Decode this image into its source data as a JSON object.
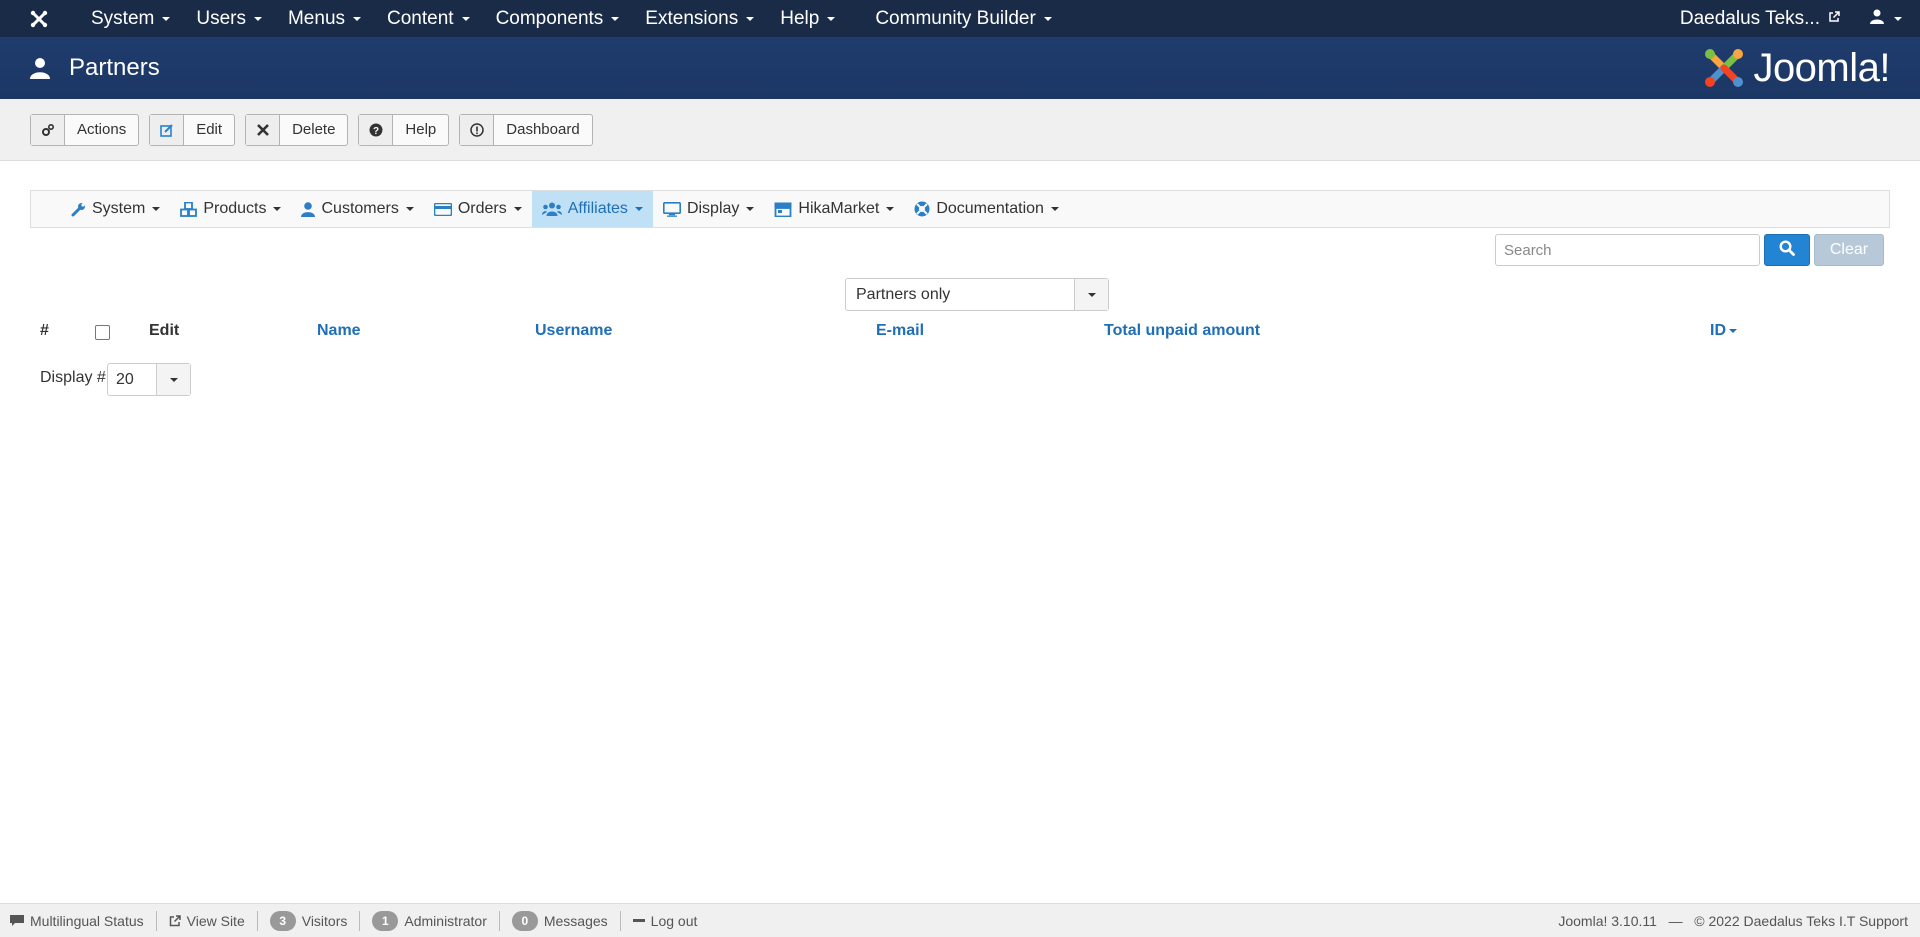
{
  "topnav": {
    "menus": [
      {
        "label": "System"
      },
      {
        "label": "Users"
      },
      {
        "label": "Menus"
      },
      {
        "label": "Content"
      },
      {
        "label": "Components"
      },
      {
        "label": "Extensions"
      },
      {
        "label": "Help"
      }
    ],
    "community_builder": "Community Builder",
    "site_name": "Daedalus Teks..."
  },
  "header": {
    "title": "Partners",
    "logo_text": "Joomla!"
  },
  "toolbar": {
    "actions": "Actions",
    "edit": "Edit",
    "delete": "Delete",
    "help": "Help",
    "dashboard": "Dashboard"
  },
  "submenu": {
    "items": [
      {
        "label": "System",
        "icon": "wrench-icon"
      },
      {
        "label": "Products",
        "icon": "cubes-icon"
      },
      {
        "label": "Customers",
        "icon": "user-icon"
      },
      {
        "label": "Orders",
        "icon": "credit-card-icon"
      },
      {
        "label": "Affiliates",
        "icon": "users-icon",
        "active": true
      },
      {
        "label": "Display",
        "icon": "monitor-icon"
      },
      {
        "label": "HikaMarket",
        "icon": "store-icon"
      },
      {
        "label": "Documentation",
        "icon": "lifebuoy-icon"
      }
    ]
  },
  "search": {
    "placeholder": "Search",
    "clear_label": "Clear"
  },
  "filter": {
    "selected": "Partners only"
  },
  "table": {
    "columns": {
      "num": "#",
      "edit": "Edit",
      "name": "Name",
      "username": "Username",
      "email": "E-mail",
      "total_unpaid": "Total unpaid amount",
      "id": "ID"
    }
  },
  "pagination": {
    "display_label": "Display #",
    "display_value": "20"
  },
  "statusbar": {
    "multilingual": "Multilingual Status",
    "view_site": "View Site",
    "visitors_count": "3",
    "visitors": "Visitors",
    "admin_count": "1",
    "administrator": "Administrator",
    "messages_count": "0",
    "messages": "Messages",
    "logout": "Log out",
    "version": "Joomla! 3.10.11",
    "separator": "—",
    "copyright": "© 2022 Daedalus Teks I.T Support"
  },
  "colors": {
    "navbar": "#1a2b48",
    "header": "#1e3a6b",
    "link": "#1f6fb5",
    "primary_button": "#2384d3",
    "active_submenu": "#bfe0f5"
  }
}
